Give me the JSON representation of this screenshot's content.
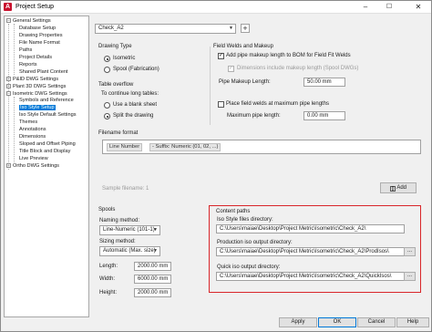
{
  "window": {
    "title": "Project Setup",
    "icon": "autocad-a-icon",
    "buttons": {
      "minimize": "–",
      "maximize": "☐",
      "close": "✕"
    }
  },
  "tree": {
    "items": [
      {
        "label": "General Settings",
        "level": 0,
        "expander": "−"
      },
      {
        "label": "Database Setup",
        "level": 1
      },
      {
        "label": "Drawing Properties",
        "level": 1
      },
      {
        "label": "File Name Format",
        "level": 1
      },
      {
        "label": "Paths",
        "level": 1
      },
      {
        "label": "Project Details",
        "level": 1
      },
      {
        "label": "Reports",
        "level": 1
      },
      {
        "label": "Shared Plant Content",
        "level": 1
      },
      {
        "label": "P&ID DWG Settings",
        "level": 0,
        "expander": "+"
      },
      {
        "label": "Plant 3D DWG Settings",
        "level": 0,
        "expander": "+"
      },
      {
        "label": "Isometric DWG Settings",
        "level": 0,
        "expander": "−"
      },
      {
        "label": "Symbols and Reference",
        "level": 1
      },
      {
        "label": "Iso Style Setup",
        "level": 1,
        "selected": true
      },
      {
        "label": "Iso Style Default Settings",
        "level": 1
      },
      {
        "label": "Themes",
        "level": 1
      },
      {
        "label": "Annotations",
        "level": 1
      },
      {
        "label": "Dimensions",
        "level": 1
      },
      {
        "label": "Sloped and Offset Piping",
        "level": 1
      },
      {
        "label": "Title Block and Display",
        "level": 1
      },
      {
        "label": "Live Preview",
        "level": 1
      },
      {
        "label": "Ortho DWG Settings",
        "level": 0,
        "expander": "+"
      }
    ]
  },
  "style_select": {
    "value": "Check_A2",
    "add_icon": "+"
  },
  "drawing_type": {
    "title": "Drawing Type",
    "options": [
      "Isometric",
      "Spool (Fabrication)"
    ],
    "selected": "Isometric"
  },
  "table_overflow": {
    "title": "Table overflow",
    "prompt": "To continue long tables:",
    "options": [
      "Use a blank sheet",
      "Split the drawing"
    ],
    "selected": "Split the drawing"
  },
  "field_welds": {
    "title": "Field Welds and Makeup",
    "add_makeup": {
      "label": "Add pipe makeup length to BOM for Field Fit Welds",
      "checked": true
    },
    "dims_include": {
      "label": "Dimensions include makeup length (Spool DWGs)",
      "checked": true
    },
    "pipe_length_label": "Pipe Makeup Length:",
    "pipe_length_value": "50.00 mm",
    "place_welds": {
      "label": "Place field welds at maximum pipe lengths",
      "checked": false
    },
    "max_length_label": "Maximum pipe length:",
    "max_length_value": "0.00 mm"
  },
  "filename_format": {
    "title": "Filename format",
    "tokens": [
      "Line Number",
      "- Suffix: Numeric (01, 02, ...)"
    ],
    "sample_label": "Sample filename: 1",
    "add_label": "Add",
    "add_icon": "add-token-icon"
  },
  "spools": {
    "title": "Spools",
    "naming_label": "Naming method:",
    "naming_value": "Line-Numeric (101-1)",
    "sizing_label": "Sizing method:",
    "sizing_value": "Automatic (Max. size)",
    "length_label": "Length:",
    "length_value": "2000.00 mm",
    "width_label": "Width:",
    "width_value": "6000.00 mm",
    "height_label": "Height:",
    "height_value": "2000.00 mm"
  },
  "content_paths": {
    "title": "Content paths",
    "style_dir_label": "Iso Style files directory:",
    "style_dir_value": "C:\\Users\\maiae\\Desktop\\Project Metric\\Isometric\\Check_A2\\",
    "prod_dir_label": "Production iso output directory:",
    "prod_dir_value": "C:\\Users\\maiae\\Desktop\\Project Metric\\Isometric\\Check_A2\\ProdIsos\\",
    "quick_dir_label": "Quick iso output directory:",
    "quick_dir_value": "C:\\Users\\maiae\\Desktop\\Project Metric\\Isometric\\Check_A2\\QuickIsos\\",
    "browse_label": "..."
  },
  "footer": {
    "apply": "Apply",
    "ok": "OK",
    "cancel": "Cancel",
    "help": "Help"
  },
  "colors": {
    "highlight": "#d9262a",
    "selection": "#0078d7"
  }
}
